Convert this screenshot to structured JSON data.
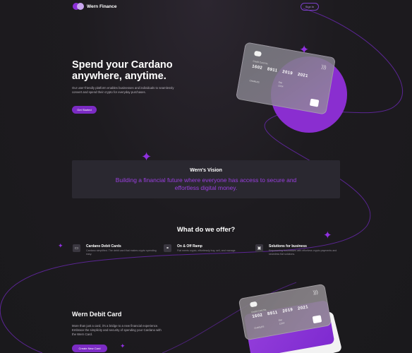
{
  "header": {
    "brand": "Wern Finance",
    "signin_label": "Sign In"
  },
  "hero": {
    "title": "Spend your Cardano anywhere, anytime.",
    "description": "Our user-friendly platform enables businesses and individuals to seamlessly convert and spend their crypto for everyday purchases.",
    "cta_label": "Get Started"
  },
  "hero_card": {
    "label": "Credit Card No.",
    "number": "1602 8911 2019 2021",
    "exp_label": "Exp",
    "exp_value": "12/24",
    "holder": "CHARLES"
  },
  "vision": {
    "title": "Wern's Vision",
    "text": "Building a financial future where everyone has access to secure and effortless digital money."
  },
  "offer": {
    "title": "What do we offer?",
    "items": [
      {
        "name": "Cardano Debit Cards",
        "desc": "Cardano simplified. The debit card that makes crypto spending easy.",
        "icon": "card-icon"
      },
      {
        "name": "On & Off Ramp",
        "desc": "Fiat meets crypto, effortlessly buy, sell, and manage.",
        "icon": "link-icon"
      },
      {
        "name": "Solutions for business",
        "desc": "Empowering businesses with effortless crypto payments and seamless fiat solutions.",
        "icon": "briefcase-icon"
      }
    ]
  },
  "debit": {
    "title": "Wern Debit Card",
    "description": "More than just a card, it's a bridge to a new financial experience. Embrace the simplicity and security of spending your Cardano with the Wern Card.",
    "cta_label": "Create New Card"
  },
  "debit_card": {
    "label": "Credit Card No.",
    "number": "1602 8911 2019 2021",
    "exp_label": "Exp",
    "exp_value": "12/24",
    "holder": "CHARLES"
  },
  "colors": {
    "accent": "#7b2bc4",
    "accent_light": "#9a3fe0",
    "background": "#1d1b1f"
  }
}
